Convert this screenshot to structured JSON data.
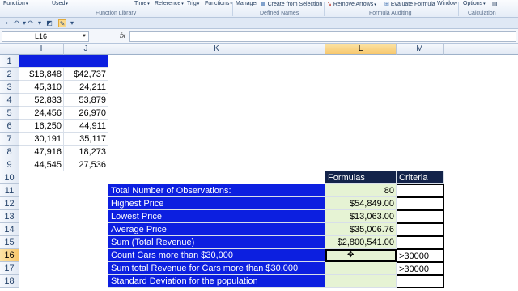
{
  "ribbon": {
    "buttons": [
      {
        "label": "Function",
        "dd": true
      },
      {
        "label": "Used",
        "dd": true
      },
      {
        "label": "Time",
        "dd": true
      },
      {
        "label": "Reference",
        "dd": true
      },
      {
        "label": "Trig",
        "dd": true
      },
      {
        "label": "Functions",
        "dd": true
      },
      {
        "label": "Manager",
        "dd": false
      },
      {
        "label": "Create from Selection",
        "dd": false
      },
      {
        "label": "Remove Arrows",
        "dd": true
      },
      {
        "label": "Evaluate Formula",
        "dd": false
      },
      {
        "label": "Window",
        "dd": false
      },
      {
        "label": "Options",
        "dd": true
      }
    ],
    "groups": [
      "Function Library",
      "Defined Names",
      "Formula Auditing",
      "Calculation"
    ]
  },
  "formula_bar": {
    "name_box": "L16",
    "fx": "fx",
    "formula": ""
  },
  "columns": [
    "I",
    "J",
    "K",
    "L",
    "M"
  ],
  "selected_column": "L",
  "selected_row": "16",
  "rows": [
    "1",
    "2",
    "3",
    "4",
    "5",
    "6",
    "7",
    "8",
    "9",
    "10",
    "11",
    "12",
    "13",
    "14",
    "15",
    "16",
    "17",
    "18"
  ],
  "data_ij": [
    [
      "$18,848",
      "$42,737"
    ],
    [
      "45,310",
      "24,211"
    ],
    [
      "52,833",
      "53,879"
    ],
    [
      "24,456",
      "26,970"
    ],
    [
      "16,250",
      "44,911"
    ],
    [
      "30,191",
      "35,117"
    ],
    [
      "47,916",
      "18,273"
    ],
    [
      "44,545",
      "27,536"
    ]
  ],
  "headers": {
    "formulas": "Formulas",
    "criteria": "Criteria"
  },
  "summary": [
    {
      "label": "Total Number of Observations:",
      "value": "80",
      "criteria": ""
    },
    {
      "label": "Highest Price",
      "value": "$54,849.00",
      "criteria": ""
    },
    {
      "label": "Lowest Price",
      "value": "$13,063.00",
      "criteria": ""
    },
    {
      "label": "Average Price",
      "value": "$35,006.76",
      "criteria": ""
    },
    {
      "label": "Sum (Total Revenue)",
      "value": "$2,800,541.00",
      "criteria": ""
    },
    {
      "label": "Count Cars more than $30,000",
      "value": "",
      "criteria": ">30000"
    },
    {
      "label": "Sum total Revenue for Cars more than $30,000",
      "value": "",
      "criteria": ">30000"
    },
    {
      "label": "Standard Deviation for the population",
      "value": "",
      "criteria": ""
    }
  ],
  "colors": {
    "label_fill": "#0c1fe0",
    "header_fill": "#13234a",
    "formula_fill": "#e6f3d4"
  }
}
